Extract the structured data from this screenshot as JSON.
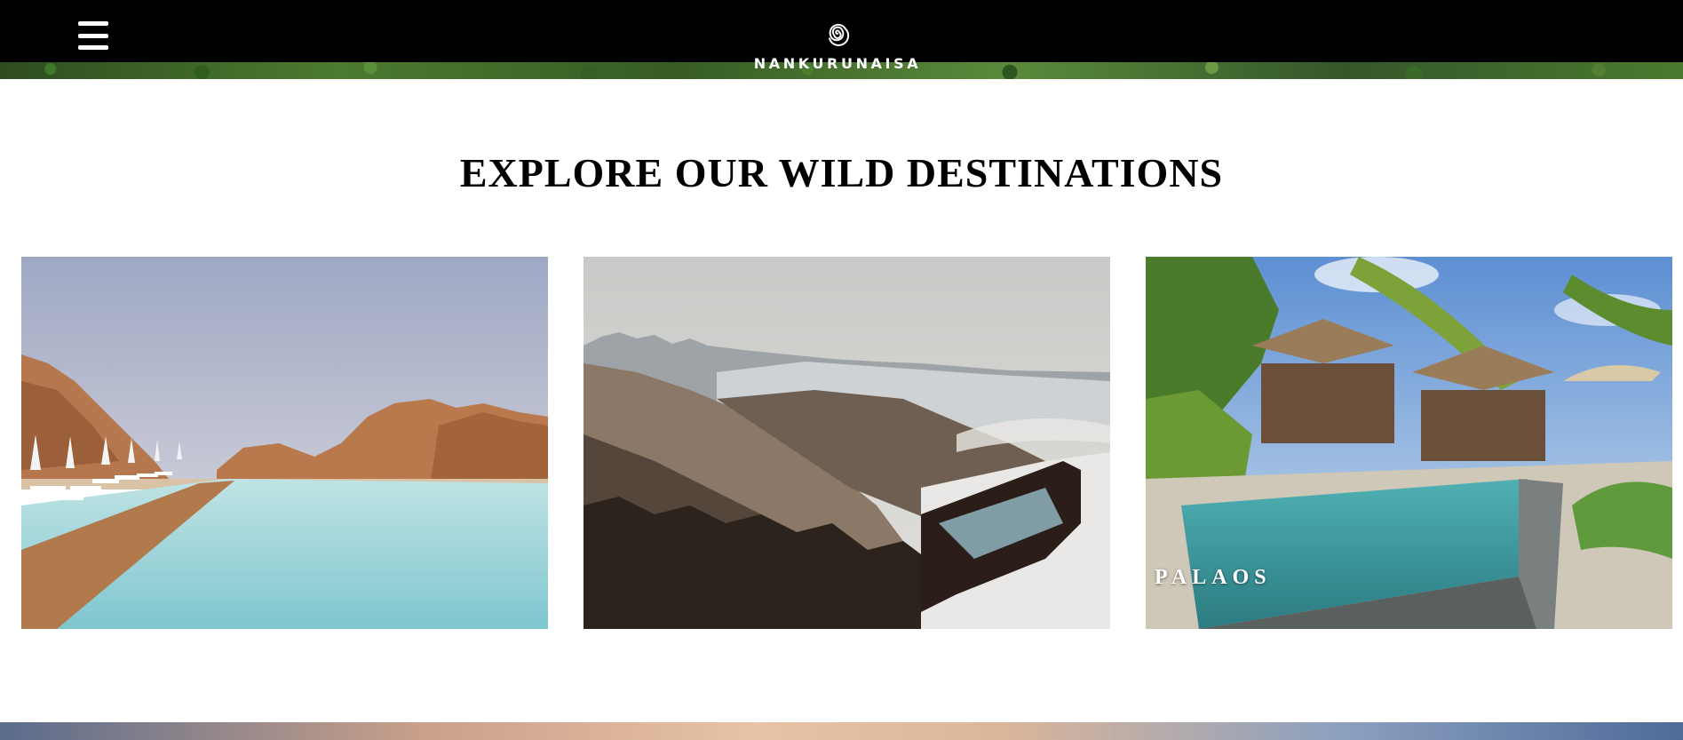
{
  "header": {
    "brand_name": "NANKURUNAISA",
    "menu_icon": "hamburger-menu-icon",
    "logo_icon": "spiral-icon"
  },
  "main": {
    "section_title": "EXPLORE OUR WILD DESTINATIONS",
    "destinations": [
      {
        "image": "desert-infinity-pool-photo",
        "label": ""
      },
      {
        "image": "snowy-mountain-forest-photo",
        "label": ""
      },
      {
        "image": "tropical-villa-pool-photo",
        "label": "PALAOS"
      }
    ]
  },
  "colors": {
    "header_bg": "#000000",
    "text_light": "#ffffff",
    "text_dark": "#000000",
    "page_bg": "#ffffff"
  }
}
